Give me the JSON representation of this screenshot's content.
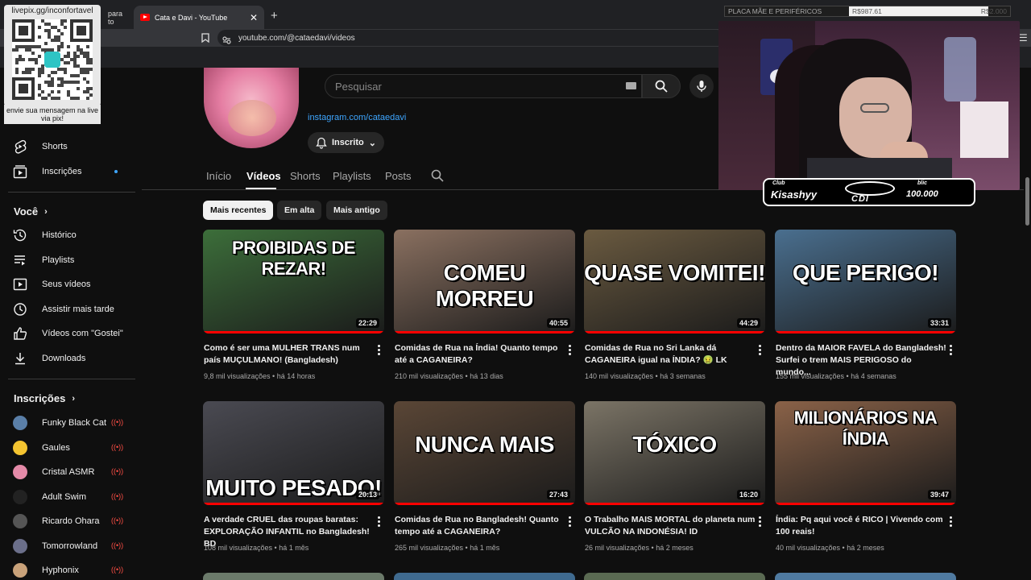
{
  "browser": {
    "tabs": [
      {
        "label": "para to"
      },
      {
        "label": "Cata e Davi - YouTube"
      }
    ],
    "url": "youtube.com/@cataedavi/videos"
  },
  "overlay": {
    "qr_url": "livepix.gg/inconfortavel",
    "qr_message": "envie sua mensagem na live via pix!",
    "goal_label": "PLACA MÃE E PERIFÉRICOS",
    "goal_current": "R$987.61",
    "goal_target": "R$2.000",
    "goal_progress": 0.49,
    "streamer_name": "Kisashyy",
    "badge_right": "100.000",
    "badge_right_top": "blic",
    "badge_logo": "CDI",
    "badge_logo_top": "Club"
  },
  "search": {
    "placeholder": "Pesquisar"
  },
  "sidebar": {
    "top_items": [
      {
        "label": "Shorts",
        "icon": "shorts-icon"
      },
      {
        "label": "Inscrições",
        "icon": "subscriptions-icon"
      }
    ],
    "you_header": "Você",
    "you_items": [
      {
        "label": "Histórico",
        "icon": "history-icon"
      },
      {
        "label": "Playlists",
        "icon": "playlists-icon"
      },
      {
        "label": "Seus vídeos",
        "icon": "your-videos-icon"
      },
      {
        "label": "Assistir mais tarde",
        "icon": "watch-later-icon"
      },
      {
        "label": "Vídeos com \"Gostei\"",
        "icon": "like-icon"
      },
      {
        "label": "Downloads",
        "icon": "download-icon"
      }
    ],
    "subs_header": "Inscrições",
    "subscriptions": [
      {
        "label": "Funky Black Cat",
        "color": "#5a7fa8"
      },
      {
        "label": "Gaules",
        "color": "#f4c430"
      },
      {
        "label": "Cristal ASMR",
        "color": "#e48aa8"
      },
      {
        "label": "Adult Swim",
        "color": "#222222"
      },
      {
        "label": "Ricardo Ohara",
        "color": "#555555"
      },
      {
        "label": "Tomorrowland",
        "color": "#6b6f8a"
      },
      {
        "label": "Hyphonix",
        "color": "#c9a27a"
      }
    ]
  },
  "channel": {
    "link": "instagram.com/cataedavi",
    "subscribe_label": "Inscrito",
    "tabs": [
      "Início",
      "Vídeos",
      "Shorts",
      "Playlists",
      "Posts"
    ],
    "active_tab": "Vídeos"
  },
  "filters": [
    "Mais recentes",
    "Em alta",
    "Mais antigo"
  ],
  "videos": [
    {
      "thumb_text": "PROIBIDAS DE REZAR!",
      "duration": "22:29",
      "title": "Como é ser uma MULHER TRANS num país MUÇULMANO! (Bangladesh)",
      "views": "9,8 mil visualizações",
      "age": "há 14 horas",
      "bg": "#3c6e3a"
    },
    {
      "thumb_text": "COMEU MORREU",
      "duration": "40:55",
      "title": "Comidas de Rua na Índia! Quanto tempo até a CAGANEIRA?",
      "views": "210 mil visualizações",
      "age": "há 13 dias",
      "bg": "#8a7060"
    },
    {
      "thumb_text": "QUASE VOMITEI!",
      "duration": "44:29",
      "title": "Comidas de Rua no Sri Lanka dá CAGANEIRA igual na ÍNDIA? 🤢 LK",
      "views": "140 mil visualizações",
      "age": "há 3 semanas",
      "bg": "#6a5a40"
    },
    {
      "thumb_text": "QUE PERIGO!",
      "duration": "33:31",
      "title": "Dentro da MAIOR FAVELA do Bangladesh! Surfei o trem MAIS PERIGOSO do mundo...",
      "views": "155 mil visualizações",
      "age": "há 4 semanas",
      "bg": "#4a6f8f"
    },
    {
      "thumb_text": "MUITO PESADO!",
      "duration": "20:13",
      "title": "A verdade CRUEL das roupas baratas: EXPLORAÇÃO INFANTIL no Bangladesh! BD",
      "views": "108 mil visualizações",
      "age": "há 1 mês",
      "bg": "#4a4a52"
    },
    {
      "thumb_text": "NUNCA MAIS",
      "duration": "27:43",
      "title": "Comidas de Rua no Bangladesh! Quanto tempo até a CAGANEIRA?",
      "views": "265 mil visualizações",
      "age": "há 1 mês",
      "bg": "#5a4636"
    },
    {
      "thumb_text": "TÓXICO",
      "duration": "16:20",
      "title": "O Trabalho MAIS MORTAL do planeta num VULCÃO NA INDONÉSIA! ID",
      "views": "26 mil visualizações",
      "age": "há 2 meses",
      "bg": "#7b7466"
    },
    {
      "thumb_text": "MILIONÁRIOS NA ÍNDIA",
      "duration": "39:47",
      "title": "Índia: Pq aqui você é RICO | Vivendo com 100 reais!",
      "views": "40 mil visualizações",
      "age": "há 2 meses",
      "bg": "#8a6248"
    }
  ]
}
